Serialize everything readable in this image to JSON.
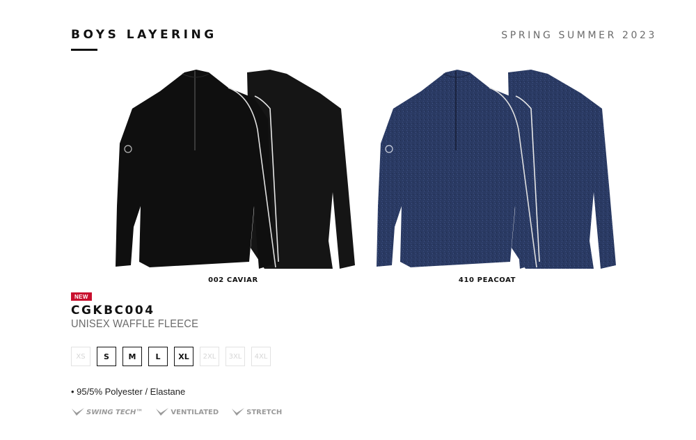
{
  "header": {
    "title": "BOYS LAYERING",
    "season": "SPRING SUMMER 2023"
  },
  "colorways": [
    {
      "label": "002 CAVIAR",
      "color": "#111111"
    },
    {
      "label": "410 PEACOAT",
      "color": "#27355a"
    }
  ],
  "product": {
    "badge": "NEW",
    "code": "CGKBC004",
    "name": "UNISEX WAFFLE FLEECE",
    "sizes": [
      {
        "label": "XS",
        "available": false
      },
      {
        "label": "S",
        "available": true
      },
      {
        "label": "M",
        "available": true
      },
      {
        "label": "L",
        "available": true
      },
      {
        "label": "XL",
        "available": true
      },
      {
        "label": "2XL",
        "available": false
      },
      {
        "label": "3XL",
        "available": false
      },
      {
        "label": "4XL",
        "available": false
      }
    ],
    "fabric": "• 95/5% Polyester / Elastane",
    "features": [
      {
        "label": "SWING TECH™",
        "icon": "check-mark-icon"
      },
      {
        "label": "VENTILATED",
        "icon": "check-mark-icon"
      },
      {
        "label": "STRETCH",
        "icon": "check-mark-icon"
      }
    ]
  }
}
